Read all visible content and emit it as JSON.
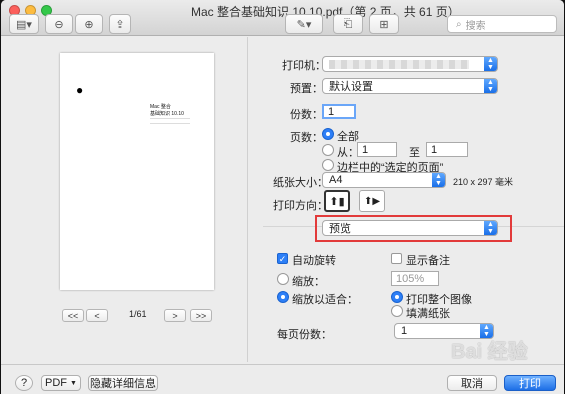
{
  "window": {
    "title": "Mac 整合基础知识 10.10.pdf（第 2 页，共 61 页）",
    "search_placeholder": "搜索"
  },
  "preview": {
    "page_title_line1": "Mac 整合",
    "page_title_line2": "基础知识 10.10",
    "page_indicator": "1/61",
    "nav_first": "<<",
    "nav_prev": "<",
    "nav_next": ">",
    "nav_last": ">>"
  },
  "settings": {
    "printer_label": "打印机：",
    "preset_label": "预置：",
    "preset_value": "默认设置",
    "copies_label": "份数：",
    "copies_value": "1",
    "pages_label": "页数：",
    "pages_all": "全部",
    "pages_from": "从：",
    "pages_from_value": "1",
    "pages_to": "至",
    "pages_to_value": "1",
    "pages_selection": "边栏中的“选定的页面”",
    "paper_label": "纸张大小：",
    "paper_value": "A4",
    "paper_dims": "210 x 297 毫米",
    "orientation_label": "打印方向：",
    "section_value": "预览",
    "highlight_color": "#e23a3a"
  },
  "options": {
    "auto_rotate": "自动旋转",
    "show_notes": "显示备注",
    "scale": "缩放：",
    "scale_value": "105%",
    "scale_to_fit": "缩放以适合：",
    "print_entire": "打印整个图像",
    "fill_paper": "填满纸张",
    "per_page_label": "每页份数：",
    "per_page_value": "1"
  },
  "footer": {
    "help": "?",
    "pdf": "PDF",
    "hide_details": "隐藏详细信息",
    "cancel": "取消",
    "print": "打印"
  },
  "watermark": "Bai 经验"
}
